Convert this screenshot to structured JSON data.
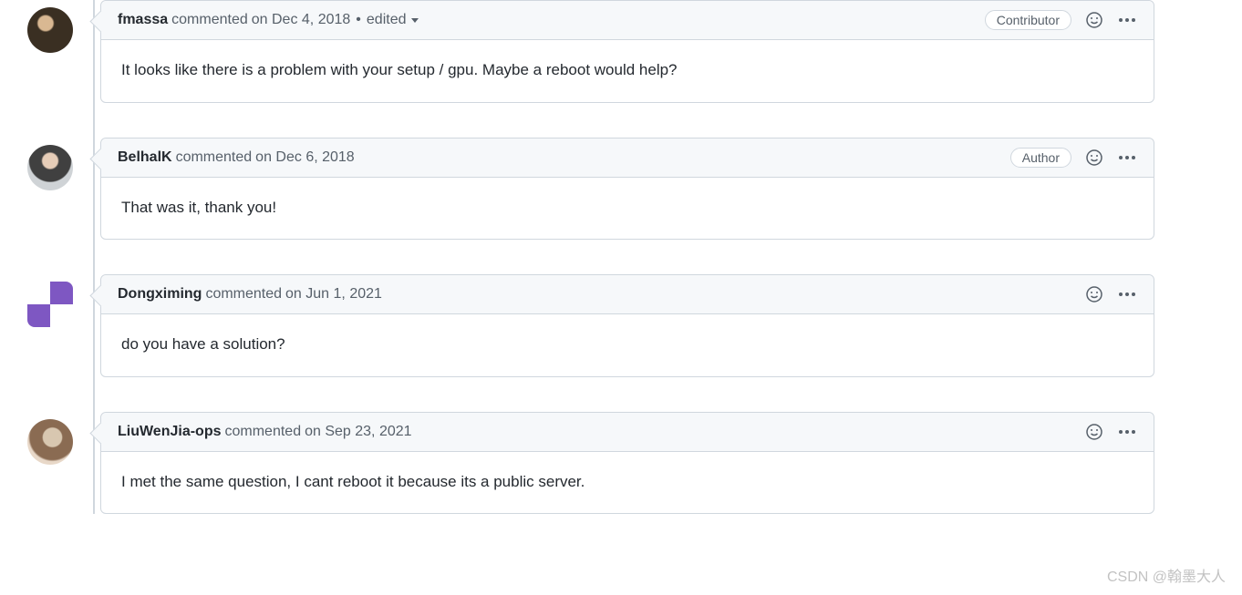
{
  "watermark": "CSDN @翰墨大人",
  "comments": [
    {
      "author": "fmassa",
      "commented_label": "commented",
      "timestamp_prefix": "on",
      "timestamp": "Dec 4, 2018",
      "edited_label": "edited",
      "has_edited": true,
      "badge": "Contributor",
      "body": "It looks like there is a problem with your setup / gpu. Maybe a reboot would help?",
      "avatar_class": "av-pic1",
      "avatar_shape": "round"
    },
    {
      "author": "BelhalK",
      "commented_label": "commented",
      "timestamp_prefix": "on",
      "timestamp": "Dec 6, 2018",
      "edited_label": "",
      "has_edited": false,
      "badge": "Author",
      "body": "That was it, thank you!",
      "avatar_class": "av-pic2",
      "avatar_shape": "round"
    },
    {
      "author": "Dongximing",
      "commented_label": "commented",
      "timestamp_prefix": "on",
      "timestamp": "Jun 1, 2021",
      "edited_label": "",
      "has_edited": false,
      "badge": "",
      "body": "do you have a solution?",
      "avatar_class": "av-pic3",
      "avatar_shape": "square"
    },
    {
      "author": "LiuWenJia-ops",
      "commented_label": "commented",
      "timestamp_prefix": "on",
      "timestamp": "Sep 23, 2021",
      "edited_label": "",
      "has_edited": false,
      "badge": "",
      "body": "I met the same question, I cant reboot it because its a public server.",
      "avatar_class": "av-pic4",
      "avatar_shape": "round"
    }
  ]
}
